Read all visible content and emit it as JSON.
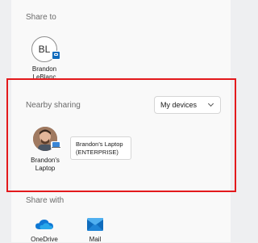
{
  "share_to": {
    "label": "Share to",
    "contact": {
      "initials": "BL",
      "name_line1": "Brandon",
      "name_line2": "LeBlanc"
    }
  },
  "nearby_sharing": {
    "label": "Nearby sharing",
    "dropdown_value": "My devices",
    "device": {
      "name_line1": "Brandon's",
      "name_line2": "Laptop",
      "tooltip_line1": "Brandon's Laptop",
      "tooltip_line2": "(ENTERPRISE)"
    }
  },
  "share_with": {
    "label": "Share with",
    "apps": [
      {
        "name": "OneDrive",
        "icon": "onedrive-icon"
      },
      {
        "name": "Mail",
        "icon": "mail-icon"
      }
    ]
  },
  "colors": {
    "highlight": "#e3191c",
    "accent": "#0f6cbd"
  }
}
